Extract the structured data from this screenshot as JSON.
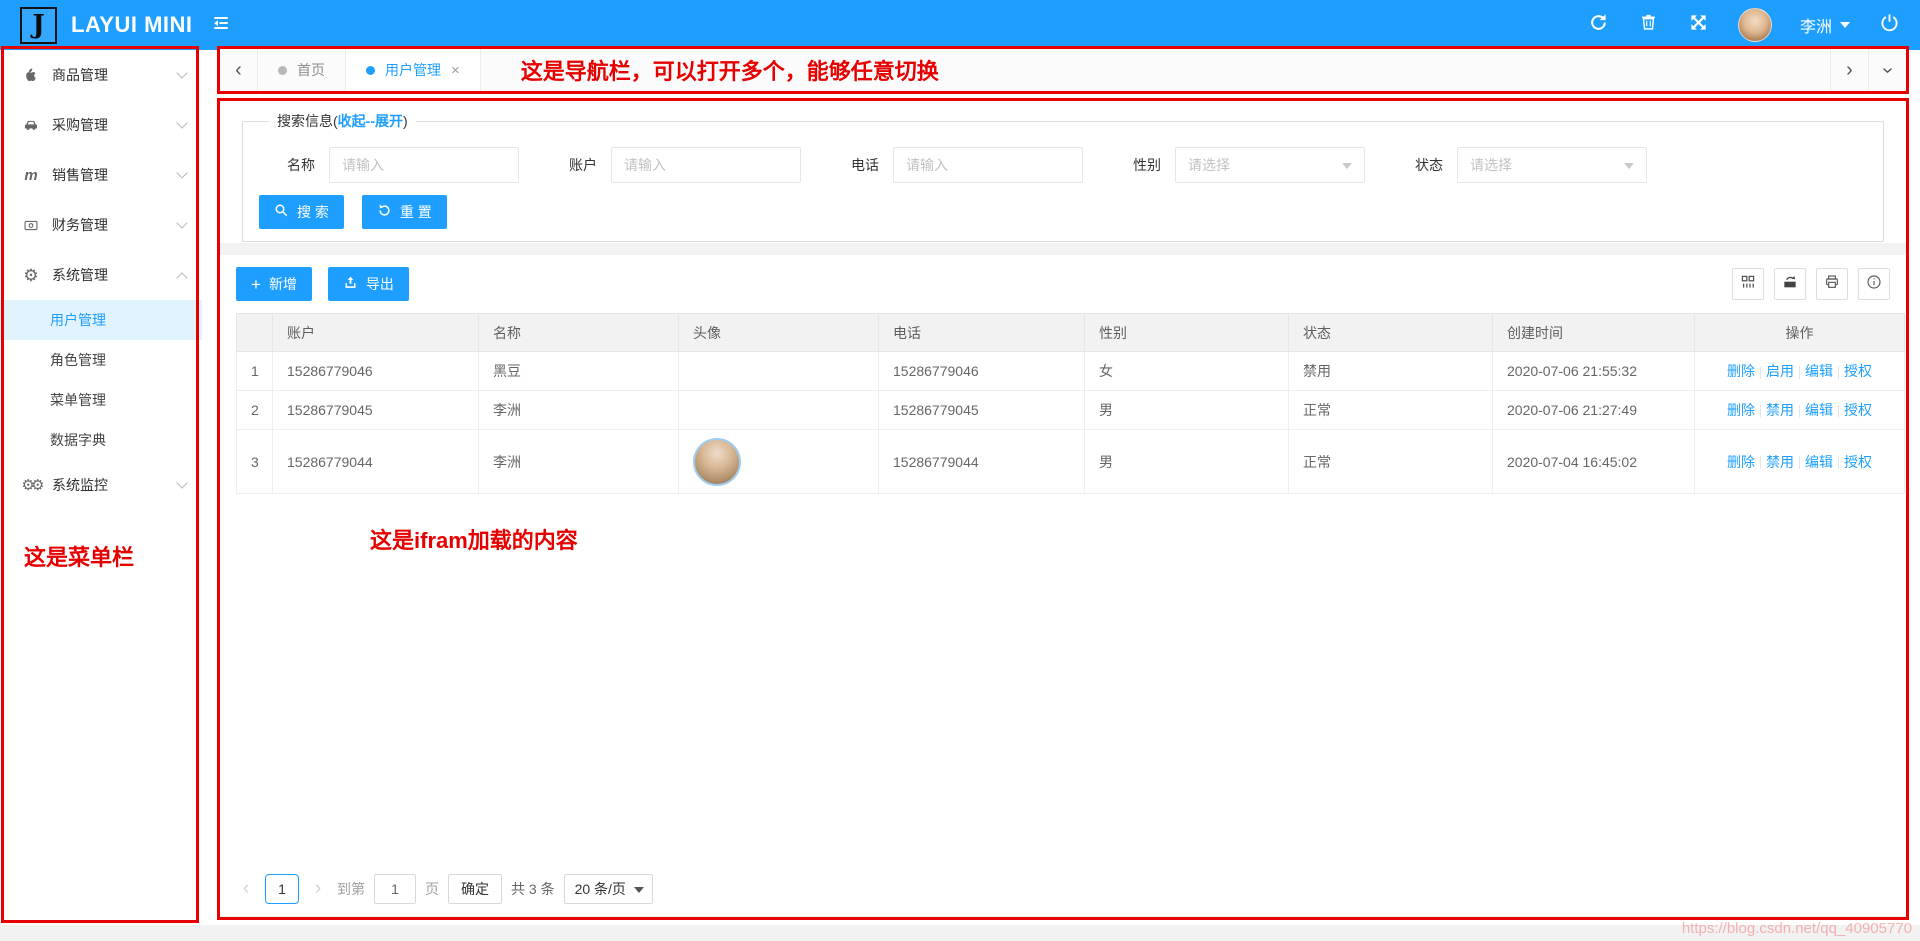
{
  "header": {
    "logo_letter": "J",
    "app_title": "LAYUI MINI",
    "user_name": "李洲",
    "icons": [
      "collapse-menu-icon",
      "refresh-icon",
      "trash-icon",
      "fullscreen-icon",
      "power-icon"
    ]
  },
  "sidebar": {
    "annotation": "这是菜单栏",
    "items": [
      {
        "label": "商品管理",
        "icon": "apple-icon"
      },
      {
        "label": "采购管理",
        "icon": "car-icon"
      },
      {
        "label": "销售管理",
        "icon": "m-icon"
      },
      {
        "label": "财务管理",
        "icon": "money-icon"
      },
      {
        "label": "系统管理",
        "icon": "gear-icon",
        "children": [
          {
            "label": "用户管理"
          },
          {
            "label": "角色管理"
          },
          {
            "label": "菜单管理"
          },
          {
            "label": "数据字典"
          }
        ]
      },
      {
        "label": "系统监控",
        "icon": "gears-icon"
      }
    ]
  },
  "tabbar": {
    "annotation": "这是导航栏，可以打开多个，能够任意切换",
    "tabs": [
      {
        "label": "首页"
      },
      {
        "label": "用户管理"
      }
    ],
    "close_glyph": "×",
    "chevron_left": "‹",
    "chevron_right": "›"
  },
  "search": {
    "legend_prefix": "搜索信息(",
    "legend_link": "收起--展开",
    "legend_suffix": ")",
    "fields": [
      {
        "label": "名称",
        "placeholder": "请输入"
      },
      {
        "label": "账户",
        "placeholder": "请输入"
      },
      {
        "label": "电话",
        "placeholder": "请输入"
      },
      {
        "label": "性别",
        "placeholder": "请选择"
      },
      {
        "label": "状态",
        "placeholder": "请选择"
      }
    ],
    "search_button": "搜 索",
    "reset_button": "重 置"
  },
  "toolbar": {
    "add_button": "新增",
    "export_button": "导出"
  },
  "table": {
    "columns": [
      "",
      "账户",
      "名称",
      "头像",
      "电话",
      "性别",
      "状态",
      "创建时间",
      "操作"
    ],
    "rows": [
      {
        "index": "1",
        "account": "15286779046",
        "name": "黑豆",
        "phone": "15286779046",
        "gender": "女",
        "status": "禁用",
        "created": "2020-07-06 21:55:32",
        "actions": [
          "删除",
          "启用",
          "编辑",
          "授权"
        ]
      },
      {
        "index": "2",
        "account": "15286779045",
        "name": "李洲",
        "phone": "15286779045",
        "gender": "男",
        "status": "正常",
        "created": "2020-07-06 21:27:49",
        "actions": [
          "删除",
          "禁用",
          "编辑",
          "授权"
        ]
      },
      {
        "index": "3",
        "account": "15286779044",
        "name": "李洲",
        "phone": "15286779044",
        "gender": "男",
        "status": "正常",
        "created": "2020-07-04 16:45:02",
        "actions": [
          "删除",
          "禁用",
          "编辑",
          "授权"
        ]
      }
    ],
    "annotation": "这是ifram加载的内容"
  },
  "pagination": {
    "prev": "‹",
    "next": "›",
    "current_page": "1",
    "goto_label": "到第",
    "goto_value": "1",
    "page_unit": "页",
    "confirm_button": "确定",
    "total_text": "共 3 条",
    "page_size": "20 条/页"
  },
  "watermark": "https://blog.csdn.net/qq_40905770",
  "colors": {
    "primary": "#1E9FFF",
    "annotation_red": "#e60000"
  }
}
